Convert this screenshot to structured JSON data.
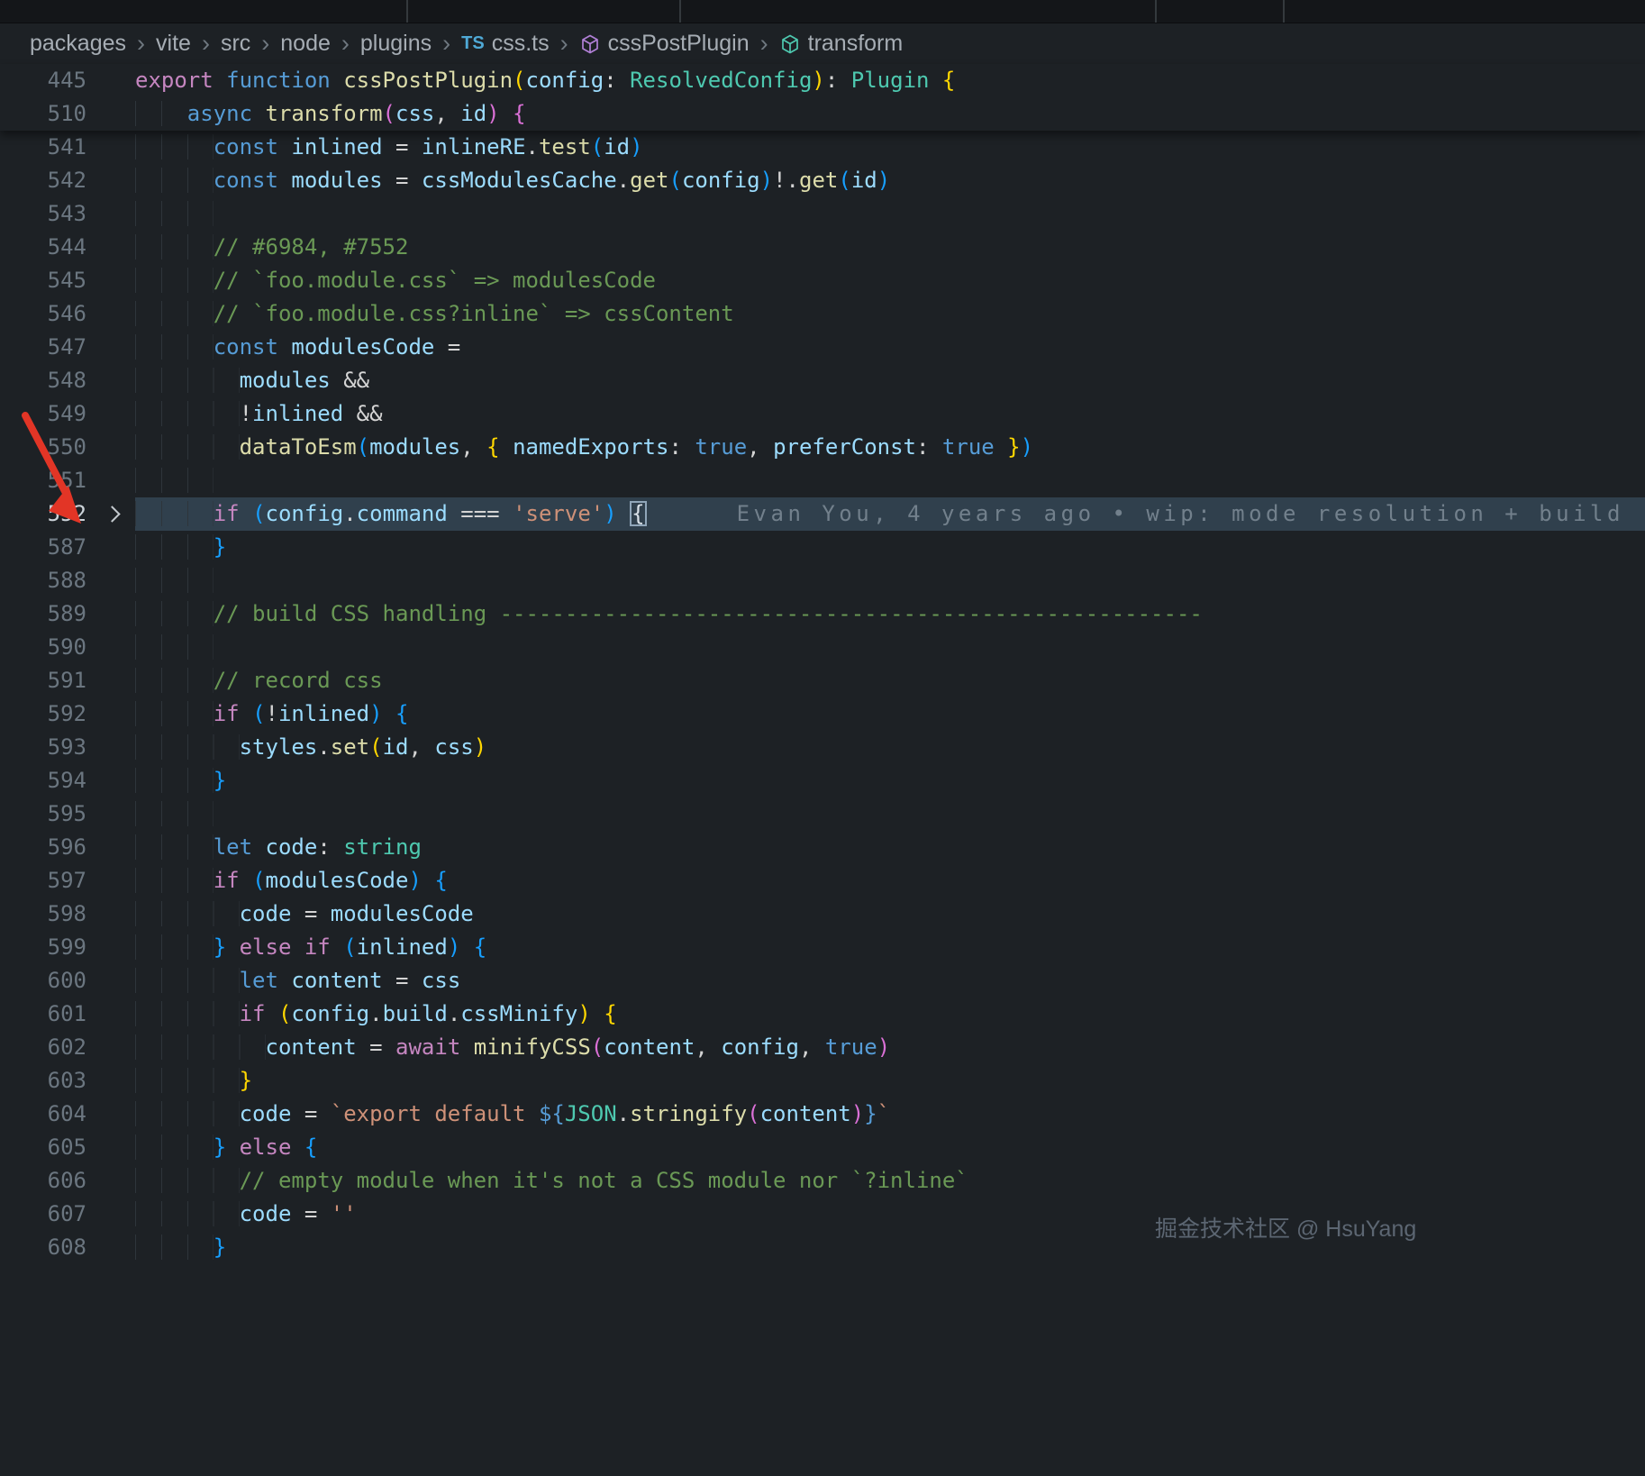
{
  "breadcrumb": {
    "separator": "›",
    "ts_icon": "TS",
    "items": [
      {
        "label": "packages"
      },
      {
        "label": "vite"
      },
      {
        "label": "src"
      },
      {
        "label": "node"
      },
      {
        "label": "plugins"
      },
      {
        "label": "css.ts"
      },
      {
        "label": "cssPostPlugin"
      },
      {
        "label": "transform"
      }
    ]
  },
  "editor": {
    "blame": "Evan You, 4 years ago • wip: mode resolution + build",
    "sticky": [
      {
        "n": 445,
        "ind": 0,
        "tk": [
          [
            "kw",
            "export"
          ],
          [
            "punc",
            " "
          ],
          [
            "kw2",
            "function"
          ],
          [
            "punc",
            " "
          ],
          [
            "fn",
            "cssPostPlugin"
          ],
          [
            "b1",
            "("
          ],
          [
            "var",
            "config"
          ],
          [
            "punc",
            ": "
          ],
          [
            "type",
            "ResolvedConfig"
          ],
          [
            "b1",
            ")"
          ],
          [
            "punc",
            ": "
          ],
          [
            "type",
            "Plugin"
          ],
          [
            "punc",
            " "
          ],
          [
            "b1",
            "{"
          ]
        ]
      },
      {
        "n": 510,
        "ind": 4,
        "tk": [
          [
            "kw2",
            "async"
          ],
          [
            "punc",
            " "
          ],
          [
            "fn",
            "transform"
          ],
          [
            "b2",
            "("
          ],
          [
            "var",
            "css"
          ],
          [
            "punc",
            ", "
          ],
          [
            "var",
            "id"
          ],
          [
            "b2",
            ")"
          ],
          [
            "punc",
            " "
          ],
          [
            "b2",
            "{"
          ]
        ]
      }
    ],
    "lines": [
      {
        "n": 541,
        "ind": 6,
        "tk": [
          [
            "kw2",
            "const"
          ],
          [
            "punc",
            " "
          ],
          [
            "var",
            "inlined"
          ],
          [
            "punc",
            " = "
          ],
          [
            "var",
            "inlineRE"
          ],
          [
            "punc",
            "."
          ],
          [
            "fn",
            "test"
          ],
          [
            "b3",
            "("
          ],
          [
            "var",
            "id"
          ],
          [
            "b3",
            ")"
          ]
        ]
      },
      {
        "n": 542,
        "ind": 6,
        "tk": [
          [
            "kw2",
            "const"
          ],
          [
            "punc",
            " "
          ],
          [
            "var",
            "modules"
          ],
          [
            "punc",
            " = "
          ],
          [
            "var",
            "cssModulesCache"
          ],
          [
            "punc",
            "."
          ],
          [
            "fn",
            "get"
          ],
          [
            "b3",
            "("
          ],
          [
            "var",
            "config"
          ],
          [
            "b3",
            ")"
          ],
          [
            "punc",
            "!."
          ],
          [
            "fn",
            "get"
          ],
          [
            "b3",
            "("
          ],
          [
            "var",
            "id"
          ],
          [
            "b3",
            ")"
          ]
        ]
      },
      {
        "n": 543,
        "ind": 6,
        "tk": []
      },
      {
        "n": 544,
        "ind": 6,
        "tk": [
          [
            "com",
            "// #6984, #7552"
          ]
        ]
      },
      {
        "n": 545,
        "ind": 6,
        "tk": [
          [
            "com",
            "// `foo.module.css` => modulesCode"
          ]
        ]
      },
      {
        "n": 546,
        "ind": 6,
        "tk": [
          [
            "com",
            "// `foo.module.css?inline` => cssContent"
          ]
        ]
      },
      {
        "n": 547,
        "ind": 6,
        "tk": [
          [
            "kw2",
            "const"
          ],
          [
            "punc",
            " "
          ],
          [
            "var",
            "modulesCode"
          ],
          [
            "punc",
            " ="
          ]
        ]
      },
      {
        "n": 548,
        "ind": 8,
        "tk": [
          [
            "var",
            "modules"
          ],
          [
            "punc",
            " &&"
          ]
        ]
      },
      {
        "n": 549,
        "ind": 8,
        "tk": [
          [
            "punc",
            "!"
          ],
          [
            "var",
            "inlined"
          ],
          [
            "punc",
            " &&"
          ]
        ]
      },
      {
        "n": 550,
        "ind": 8,
        "tk": [
          [
            "fn",
            "dataToEsm"
          ],
          [
            "b3",
            "("
          ],
          [
            "var",
            "modules"
          ],
          [
            "punc",
            ", "
          ],
          [
            "b1",
            "{"
          ],
          [
            "punc",
            " "
          ],
          [
            "var",
            "namedExports"
          ],
          [
            "punc",
            ": "
          ],
          [
            "kw2",
            "true"
          ],
          [
            "punc",
            ", "
          ],
          [
            "var",
            "preferConst"
          ],
          [
            "punc",
            ": "
          ],
          [
            "kw2",
            "true"
          ],
          [
            "punc",
            " "
          ],
          [
            "b1",
            "}"
          ],
          [
            "b3",
            ")"
          ]
        ]
      },
      {
        "n": 551,
        "ind": 6,
        "tk": []
      },
      {
        "n": 552,
        "ind": 6,
        "fold": true,
        "hl": true,
        "blame": true,
        "tk": [
          [
            "kw",
            "if"
          ],
          [
            "punc",
            " "
          ],
          [
            "b3",
            "("
          ],
          [
            "var",
            "config"
          ],
          [
            "punc",
            "."
          ],
          [
            "var",
            "command"
          ],
          [
            "punc",
            " === "
          ],
          [
            "str",
            "'serve'"
          ],
          [
            "b3",
            ")"
          ],
          [
            "punc",
            " "
          ],
          [
            "b3x",
            "{"
          ]
        ]
      },
      {
        "n": 587,
        "ind": 6,
        "tk": [
          [
            "b3",
            "}"
          ]
        ]
      },
      {
        "n": 588,
        "ind": 6,
        "tk": []
      },
      {
        "n": 589,
        "ind": 6,
        "tk": [
          [
            "com",
            "// build CSS handling ------------------------------------------------------"
          ]
        ]
      },
      {
        "n": 590,
        "ind": 6,
        "tk": []
      },
      {
        "n": 591,
        "ind": 6,
        "tk": [
          [
            "com",
            "// record css"
          ]
        ]
      },
      {
        "n": 592,
        "ind": 6,
        "tk": [
          [
            "kw",
            "if"
          ],
          [
            "punc",
            " "
          ],
          [
            "b3",
            "("
          ],
          [
            "punc",
            "!"
          ],
          [
            "var",
            "inlined"
          ],
          [
            "b3",
            ")"
          ],
          [
            "punc",
            " "
          ],
          [
            "b3",
            "{"
          ]
        ]
      },
      {
        "n": 593,
        "ind": 8,
        "tk": [
          [
            "var",
            "styles"
          ],
          [
            "punc",
            "."
          ],
          [
            "fn",
            "set"
          ],
          [
            "b1",
            "("
          ],
          [
            "var",
            "id"
          ],
          [
            "punc",
            ", "
          ],
          [
            "var",
            "css"
          ],
          [
            "b1",
            ")"
          ]
        ]
      },
      {
        "n": 594,
        "ind": 6,
        "tk": [
          [
            "b3",
            "}"
          ]
        ]
      },
      {
        "n": 595,
        "ind": 6,
        "tk": []
      },
      {
        "n": 596,
        "ind": 6,
        "tk": [
          [
            "kw2",
            "let"
          ],
          [
            "punc",
            " "
          ],
          [
            "var",
            "code"
          ],
          [
            "punc",
            ": "
          ],
          [
            "type",
            "string"
          ]
        ]
      },
      {
        "n": 597,
        "ind": 6,
        "tk": [
          [
            "kw",
            "if"
          ],
          [
            "punc",
            " "
          ],
          [
            "b3",
            "("
          ],
          [
            "var",
            "modulesCode"
          ],
          [
            "b3",
            ")"
          ],
          [
            "punc",
            " "
          ],
          [
            "b3",
            "{"
          ]
        ]
      },
      {
        "n": 598,
        "ind": 8,
        "tk": [
          [
            "var",
            "code"
          ],
          [
            "punc",
            " = "
          ],
          [
            "var",
            "modulesCode"
          ]
        ]
      },
      {
        "n": 599,
        "ind": 6,
        "tk": [
          [
            "b3",
            "}"
          ],
          [
            "punc",
            " "
          ],
          [
            "kw",
            "else"
          ],
          [
            "punc",
            " "
          ],
          [
            "kw",
            "if"
          ],
          [
            "punc",
            " "
          ],
          [
            "b3",
            "("
          ],
          [
            "var",
            "inlined"
          ],
          [
            "b3",
            ")"
          ],
          [
            "punc",
            " "
          ],
          [
            "b3",
            "{"
          ]
        ]
      },
      {
        "n": 600,
        "ind": 8,
        "tk": [
          [
            "kw2",
            "let"
          ],
          [
            "punc",
            " "
          ],
          [
            "var",
            "content"
          ],
          [
            "punc",
            " = "
          ],
          [
            "var",
            "css"
          ]
        ]
      },
      {
        "n": 601,
        "ind": 8,
        "tk": [
          [
            "kw",
            "if"
          ],
          [
            "punc",
            " "
          ],
          [
            "b1",
            "("
          ],
          [
            "var",
            "config"
          ],
          [
            "punc",
            "."
          ],
          [
            "var",
            "build"
          ],
          [
            "punc",
            "."
          ],
          [
            "var",
            "cssMinify"
          ],
          [
            "b1",
            ")"
          ],
          [
            "punc",
            " "
          ],
          [
            "b1",
            "{"
          ]
        ]
      },
      {
        "n": 602,
        "ind": 10,
        "tk": [
          [
            "var",
            "content"
          ],
          [
            "punc",
            " = "
          ],
          [
            "kw",
            "await"
          ],
          [
            "punc",
            " "
          ],
          [
            "fn",
            "minifyCSS"
          ],
          [
            "b2",
            "("
          ],
          [
            "var",
            "content"
          ],
          [
            "punc",
            ", "
          ],
          [
            "var",
            "config"
          ],
          [
            "punc",
            ", "
          ],
          [
            "kw2",
            "true"
          ],
          [
            "b2",
            ")"
          ]
        ]
      },
      {
        "n": 603,
        "ind": 8,
        "tk": [
          [
            "b1",
            "}"
          ]
        ]
      },
      {
        "n": 604,
        "ind": 8,
        "tk": [
          [
            "var",
            "code"
          ],
          [
            "punc",
            " = "
          ],
          [
            "str",
            "`export default "
          ],
          [
            "kw2",
            "${"
          ],
          [
            "type",
            "JSON"
          ],
          [
            "punc",
            "."
          ],
          [
            "fn",
            "stringify"
          ],
          [
            "b2",
            "("
          ],
          [
            "var",
            "content"
          ],
          [
            "b2",
            ")"
          ],
          [
            "kw2",
            "}"
          ],
          [
            "str",
            "`"
          ]
        ]
      },
      {
        "n": 605,
        "ind": 6,
        "tk": [
          [
            "b3",
            "}"
          ],
          [
            "punc",
            " "
          ],
          [
            "kw",
            "else"
          ],
          [
            "punc",
            " "
          ],
          [
            "b3",
            "{"
          ]
        ]
      },
      {
        "n": 606,
        "ind": 8,
        "tk": [
          [
            "com",
            "// empty module when it's not a CSS module nor `?inline`"
          ]
        ]
      },
      {
        "n": 607,
        "ind": 8,
        "tk": [
          [
            "var",
            "code"
          ],
          [
            "punc",
            " = "
          ],
          [
            "str",
            "''"
          ]
        ]
      },
      {
        "n": 608,
        "ind": 6,
        "tk": [
          [
            "b3",
            "}"
          ]
        ]
      }
    ]
  },
  "watermark": "掘金技术社区 @ HsuYang",
  "palette": {
    "background": "#1d2125",
    "tab_strip": "#141619",
    "line_number": "#6b7680",
    "highlight_line": "rgba(88,128,162,0.33)",
    "keyword_control": "#C586C0",
    "keyword": "#569CD6",
    "function": "#DCDCAA",
    "variable": "#9CDCFE",
    "string": "#CE9178",
    "comment": "#6A9955",
    "type": "#4EC9B0",
    "bracket_gold": "#FFD700",
    "bracket_orchid": "#DA70D6",
    "bracket_blue": "#179FFF",
    "blame_text": "#72808c",
    "arrow_red": "#e23526",
    "ts_icon_blue": "#4FA9D6",
    "symbol_icon_purple": "#B180D7",
    "symbol_icon_teal": "#4EC9B0"
  }
}
